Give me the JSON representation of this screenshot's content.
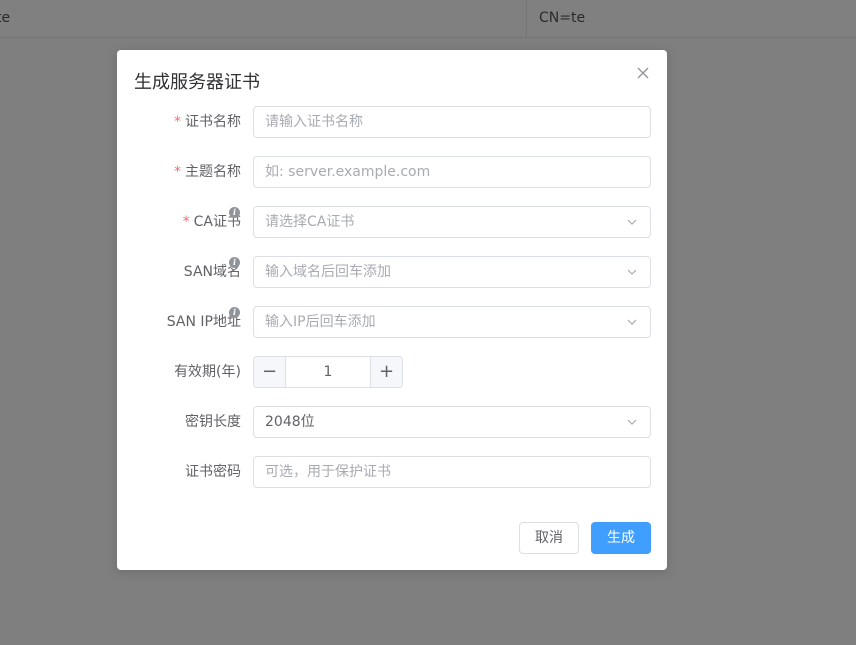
{
  "background": {
    "cell_a": "te",
    "cell_b": "CN=te"
  },
  "dialog": {
    "title": "生成服务器证书",
    "close_icon": "close-icon",
    "fields": {
      "cert_name": {
        "label": "证书名称",
        "required": true,
        "placeholder": "请输入证书名称",
        "value": ""
      },
      "subject_name": {
        "label": "主题名称",
        "required": true,
        "placeholder": "如: server.example.com",
        "value": ""
      },
      "ca_cert": {
        "label": "CA证书",
        "required": true,
        "info": true,
        "placeholder": "请选择CA证书",
        "value": ""
      },
      "san_domain": {
        "label": "SAN域名",
        "info": true,
        "placeholder": "输入域名后回车添加",
        "value": ""
      },
      "san_ip": {
        "label": "SAN IP地址",
        "info": true,
        "placeholder": "输入IP后回车添加",
        "value": ""
      },
      "validity": {
        "label": "有效期(年)",
        "value": "1",
        "minus": "−",
        "plus": "+"
      },
      "key_length": {
        "label": "密钥长度",
        "value": "2048位"
      },
      "cert_password": {
        "label": "证书密码",
        "placeholder": "可选，用于保护证书",
        "value": ""
      }
    },
    "required_mark": "*",
    "info_glyph": "i",
    "buttons": {
      "cancel": "取消",
      "submit": "生成"
    },
    "colors": {
      "primary": "#409eff",
      "required": "#f56c6c"
    }
  }
}
